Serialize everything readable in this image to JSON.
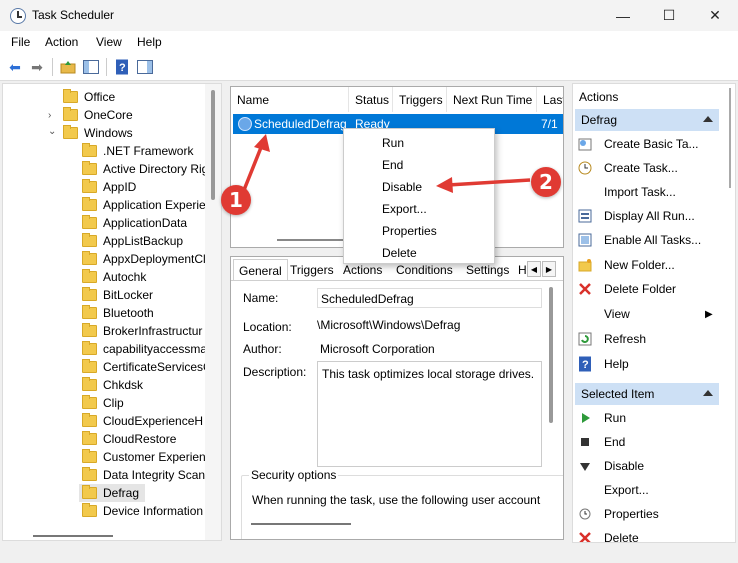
{
  "window": {
    "title": "Task Scheduler",
    "minimize": "—",
    "maximize": "☐",
    "close": "✕"
  },
  "menu": [
    "File",
    "Action",
    "View",
    "Help"
  ],
  "tree": {
    "items": [
      {
        "label": "Office"
      },
      {
        "label": "OneCore"
      },
      {
        "label": "Windows"
      },
      {
        "label": ".NET Framework"
      },
      {
        "label": "Active Directory Rig"
      },
      {
        "label": "AppID"
      },
      {
        "label": "Application Experie"
      },
      {
        "label": "ApplicationData"
      },
      {
        "label": "AppListBackup"
      },
      {
        "label": "AppxDeploymentCl"
      },
      {
        "label": "Autochk"
      },
      {
        "label": "BitLocker"
      },
      {
        "label": "Bluetooth"
      },
      {
        "label": "BrokerInfrastructur"
      },
      {
        "label": "capabilityaccessma"
      },
      {
        "label": "CertificateServicesC"
      },
      {
        "label": "Chkdsk"
      },
      {
        "label": "Clip"
      },
      {
        "label": "CloudExperienceH"
      },
      {
        "label": "CloudRestore"
      },
      {
        "label": "Customer Experien"
      },
      {
        "label": "Data Integrity Scan"
      },
      {
        "label": "Defrag"
      },
      {
        "label": "Device Information"
      }
    ]
  },
  "tasklist": {
    "columns": [
      "Name",
      "Status",
      "Triggers",
      "Next Run Time",
      "Last"
    ],
    "row": {
      "name": "ScheduledDefrag",
      "status": "Ready",
      "last": "7/1"
    }
  },
  "context_menu": [
    "Run",
    "End",
    "Disable",
    "Export...",
    "Properties",
    "Delete"
  ],
  "details": {
    "tabs": [
      "General",
      "Triggers",
      "Actions",
      "Conditions",
      "Settings",
      "H"
    ],
    "name_label": "Name:",
    "name_value": "ScheduledDefrag",
    "location_label": "Location:",
    "location_value": "\\Microsoft\\Windows\\Defrag",
    "author_label": "Author:",
    "author_value": "Microsoft Corporation",
    "description_label": "Description:",
    "description_value": "This task optimizes local storage drives.",
    "security_title": "Security options",
    "security_text": "When running the task, use the following user account"
  },
  "actions": {
    "header": "Actions",
    "section1": "Defrag",
    "section1_items": [
      {
        "label": "Create Basic Ta...",
        "icon": "create-basic-task-icon"
      },
      {
        "label": "Create Task...",
        "icon": "create-task-icon"
      },
      {
        "label": "Import Task...",
        "icon": ""
      },
      {
        "label": "Display All Run...",
        "icon": "display-running-icon"
      },
      {
        "label": "Enable All Tasks...",
        "icon": "enable-history-icon"
      },
      {
        "label": "New Folder...",
        "icon": "new-folder-icon"
      },
      {
        "label": "Delete Folder",
        "icon": "delete-icon"
      },
      {
        "label": "View",
        "icon": ""
      },
      {
        "label": "Refresh",
        "icon": "refresh-icon"
      },
      {
        "label": "Help",
        "icon": "help-icon"
      }
    ],
    "section2": "Selected Item",
    "section2_items": [
      {
        "label": "Run",
        "icon": "run-icon"
      },
      {
        "label": "End",
        "icon": "end-icon"
      },
      {
        "label": "Disable",
        "icon": "disable-icon"
      },
      {
        "label": "Export...",
        "icon": ""
      },
      {
        "label": "Properties",
        "icon": "properties-icon"
      },
      {
        "label": "Delete",
        "icon": "delete-icon"
      }
    ]
  },
  "annotations": {
    "badge1": "1",
    "badge2": "2"
  },
  "colors": {
    "selection": "#0078d7",
    "section_header": "#cde0f5",
    "annotation": "#e03a33"
  }
}
